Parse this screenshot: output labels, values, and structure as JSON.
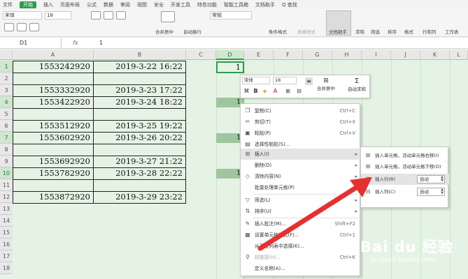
{
  "menubar": {
    "items": [
      "文件",
      "开始",
      "插入",
      "页面布局",
      "公式",
      "数据",
      "审阅",
      "视图",
      "安全",
      "开发工具",
      "特色功能",
      "智能工具箱",
      "文档助手",
      "Q 查找"
    ],
    "active_index": 1
  },
  "ribbon": {
    "font_name": "宋体",
    "font_size": "18",
    "number_format": "常规",
    "merge_label": "合并居中",
    "autowrap_label": "自动换行",
    "cond_format_label": "条件格式",
    "table_style_label": "表格样式",
    "doc_helper_label": "文档助手",
    "sum_label": "求和",
    "filter_label": "筛选",
    "sort_label": "排序",
    "format_label": "格式",
    "rowcol_label": "行和列",
    "sheet_label": "工作表"
  },
  "formula_bar": {
    "cell_ref": "D1",
    "fx_label": "fx",
    "value": "1"
  },
  "columns": [
    "A",
    "B",
    "C",
    "D",
    "E",
    "F",
    "G",
    "H",
    "I",
    "J",
    "K",
    "L"
  ],
  "rows": [
    "1",
    "2",
    "3",
    "4",
    "5",
    "6",
    "7",
    "8",
    "9",
    "10",
    "11",
    "12",
    "13",
    "14",
    "15",
    "16",
    "17",
    "18"
  ],
  "cells": {
    "d1": "1",
    "a": [
      "1553242920",
      "",
      "1553332920",
      "1553422920",
      "",
      "1553512920",
      "1553602920",
      "",
      "1553692920",
      "1553782920",
      "",
      "1553872920"
    ],
    "b": [
      "2019-3-22 16:22",
      "",
      "2019-3-23 17:22",
      "2019-3-24 18:22",
      "",
      "2019-3-25 19:22",
      "2019-3-26 20:22",
      "",
      "2019-3-27 21:22",
      "2019-3-28 22:22",
      "",
      "2019-3-29 23:22"
    ],
    "d_marks": [
      "1",
      "1",
      "1"
    ]
  },
  "mini_toolbar": {
    "font": "宋体",
    "size": "18",
    "merge_label": "合并居中",
    "sum_label": "自动求和"
  },
  "context_menu": {
    "items": [
      {
        "icon": "copy-icon",
        "label": "复制(C)",
        "shortcut": "Ctrl+C"
      },
      {
        "icon": "cut-icon",
        "label": "剪切(T)",
        "shortcut": "Ctrl+X"
      },
      {
        "icon": "paste-icon",
        "label": "粘贴(P)",
        "shortcut": "Ctrl+V"
      },
      {
        "icon": "paste-special-icon",
        "label": "选择性粘贴(S)...",
        "shortcut": ""
      },
      {
        "icon": "insert-icon",
        "label": "插入(I)",
        "shortcut": ""
      },
      {
        "icon": "",
        "label": "删除(D)",
        "shortcut": ""
      },
      {
        "icon": "clear-icon",
        "label": "清除内容(N)",
        "shortcut": ""
      },
      {
        "icon": "",
        "label": "批量处理单元格(P)",
        "shortcut": ""
      },
      {
        "icon": "filter-icon",
        "label": "筛选(L)",
        "shortcut": ""
      },
      {
        "icon": "sort-icon",
        "label": "排序(U)",
        "shortcut": ""
      },
      {
        "icon": "comment-icon",
        "label": "插入批注(M)...",
        "shortcut": "Shift+F2"
      },
      {
        "icon": "format-cells-icon",
        "label": "设置单元格格式(F)...",
        "shortcut": "Ctrl+1"
      },
      {
        "icon": "",
        "label": "从下拉列表中选择(K)...",
        "shortcut": ""
      },
      {
        "icon": "link-icon",
        "label": "超链接(H)...",
        "shortcut": "Ctrl+K"
      },
      {
        "icon": "",
        "label": "定义名称(A)...",
        "shortcut": ""
      }
    ]
  },
  "submenu": {
    "items": [
      {
        "label": "插入单元格，活动单元格右移(I)"
      },
      {
        "label": "插入单元格，活动单元格下移(D)"
      },
      {
        "label": "插入行(R)",
        "spin": "自动"
      },
      {
        "label": "插入列(C)",
        "spin": "自动"
      }
    ]
  },
  "watermark": {
    "brand": "Bai du 经验",
    "url": "jingyan.baidu.com"
  },
  "colors": {
    "accent": "#2e9b4f",
    "sheet_bg": "#e5f3e5",
    "arrow": "#e53030"
  }
}
